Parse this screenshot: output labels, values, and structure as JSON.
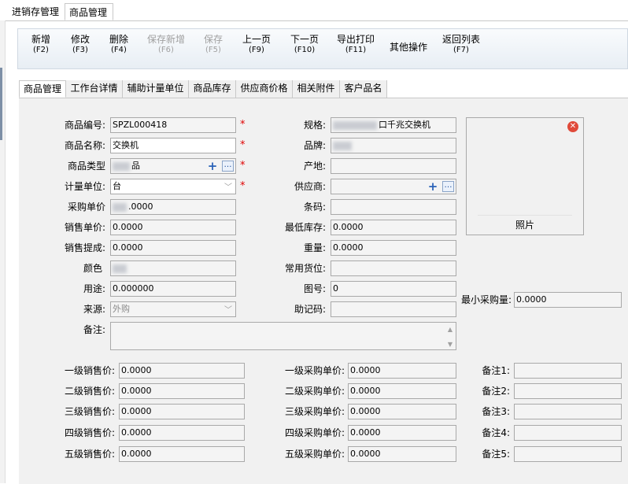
{
  "top_tabs": [
    {
      "label": "进销存管理"
    },
    {
      "label": "商品管理"
    }
  ],
  "toolbar": [
    {
      "label": "新增",
      "key": "(F2)",
      "disabled": false
    },
    {
      "label": "修改",
      "key": "(F3)",
      "disabled": false
    },
    {
      "label": "删除",
      "key": "(F4)",
      "disabled": false
    },
    {
      "label": "保存新增",
      "key": "(F6)",
      "disabled": true
    },
    {
      "label": "保存",
      "key": "(F5)",
      "disabled": true
    },
    {
      "label": "上一页",
      "key": "(F9)",
      "disabled": false
    },
    {
      "label": "下一页",
      "key": "(F10)",
      "disabled": false
    },
    {
      "label": "导出打印",
      "key": "(F11)",
      "disabled": false
    },
    {
      "label": "其他操作",
      "key": "",
      "disabled": false
    },
    {
      "label": "返回列表",
      "key": "(F7)",
      "disabled": false
    }
  ],
  "sub_tabs": [
    {
      "label": "商品管理"
    },
    {
      "label": "工作台详情"
    },
    {
      "label": "辅助计量单位"
    },
    {
      "label": "商品库存"
    },
    {
      "label": "供应商价格"
    },
    {
      "label": "相关附件"
    },
    {
      "label": "客户品名"
    }
  ],
  "form": {
    "code": {
      "label": "商品编号:",
      "value": "SPZL000418"
    },
    "name": {
      "label": "商品名称:",
      "value": "交换机"
    },
    "type": {
      "label": "商品类型",
      "value": "品"
    },
    "unit": {
      "label": "计量单位:",
      "value": "台"
    },
    "purchase_price": {
      "label": "采购单价",
      "value": ".0000"
    },
    "sale_price": {
      "label": "销售单价:",
      "value": "0.0000"
    },
    "commission": {
      "label": "销售提成:",
      "value": "0.0000"
    },
    "color": {
      "label": "颜色",
      "value": ""
    },
    "usage": {
      "label": "用途:",
      "value": "0.000000"
    },
    "source": {
      "label": "来源:",
      "value": "外购"
    },
    "remark": {
      "label": "备注:",
      "value": ""
    },
    "spec": {
      "label": "规格:",
      "value": "口千兆交换机"
    },
    "brand": {
      "label": "品牌:",
      "value": ""
    },
    "origin": {
      "label": "产地:",
      "value": ""
    },
    "supplier": {
      "label": "供应商:",
      "value": ""
    },
    "barcode": {
      "label": "条码:",
      "value": ""
    },
    "min_stock": {
      "label": "最低库存:",
      "value": "0.0000"
    },
    "weight": {
      "label": "重量:",
      "value": "0.0000"
    },
    "location": {
      "label": "常用货位:",
      "value": ""
    },
    "drawing_no": {
      "label": "图号:",
      "value": "0"
    },
    "mnemonic": {
      "label": "助记码:",
      "value": ""
    },
    "min_purchase": {
      "label": "最小采购量:",
      "value": "0.0000"
    },
    "photo_label": "照片"
  },
  "levels": {
    "sale": [
      {
        "label": "一级销售价:",
        "value": "0.0000"
      },
      {
        "label": "二级销售价:",
        "value": "0.0000"
      },
      {
        "label": "三级销售价:",
        "value": "0.0000"
      },
      {
        "label": "四级销售价:",
        "value": "0.0000"
      },
      {
        "label": "五级销售价:",
        "value": "0.0000"
      }
    ],
    "purchase": [
      {
        "label": "一级采购单价:",
        "value": "0.0000"
      },
      {
        "label": "二级采购单价:",
        "value": "0.0000"
      },
      {
        "label": "三级采购单价:",
        "value": "0.0000"
      },
      {
        "label": "四级采购单价:",
        "value": "0.0000"
      },
      {
        "label": "五级采购单价:",
        "value": "0.0000"
      }
    ],
    "notes": [
      {
        "label": "备注1:",
        "value": ""
      },
      {
        "label": "备注2:",
        "value": ""
      },
      {
        "label": "备注3:",
        "value": ""
      },
      {
        "label": "备注4:",
        "value": ""
      },
      {
        "label": "备注5:",
        "value": ""
      }
    ]
  },
  "required_mark": "*",
  "icons": {
    "add": "plus-icon",
    "browse": "ellipsis-icon",
    "close": "close-icon",
    "dropdown": "chevron-down-icon"
  }
}
